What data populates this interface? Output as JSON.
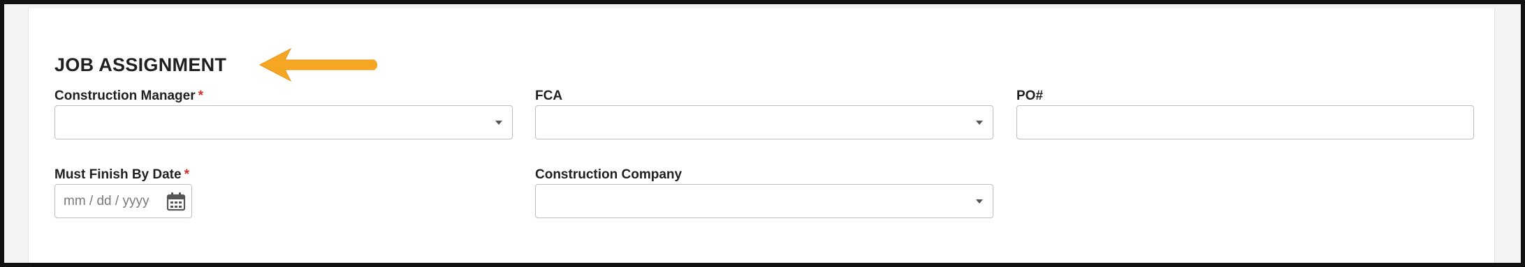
{
  "section": {
    "title": "JOB ASSIGNMENT"
  },
  "fields": {
    "construction_manager": {
      "label": "Construction Manager",
      "required_mark": "*",
      "value": ""
    },
    "fca": {
      "label": "FCA",
      "value": ""
    },
    "po": {
      "label": "PO#",
      "value": ""
    },
    "must_finish_by_date": {
      "label": "Must Finish By Date",
      "required_mark": "*",
      "placeholder": "mm / dd / yyyy"
    },
    "construction_company": {
      "label": "Construction Company",
      "value": ""
    }
  },
  "icons": {
    "dropdown": "chevron-down-icon",
    "calendar": "calendar-icon",
    "annotation": "arrow-left-icon"
  },
  "colors": {
    "required": "#d0312d",
    "arrow": "#f5a623",
    "border": "#bfbfbf"
  }
}
